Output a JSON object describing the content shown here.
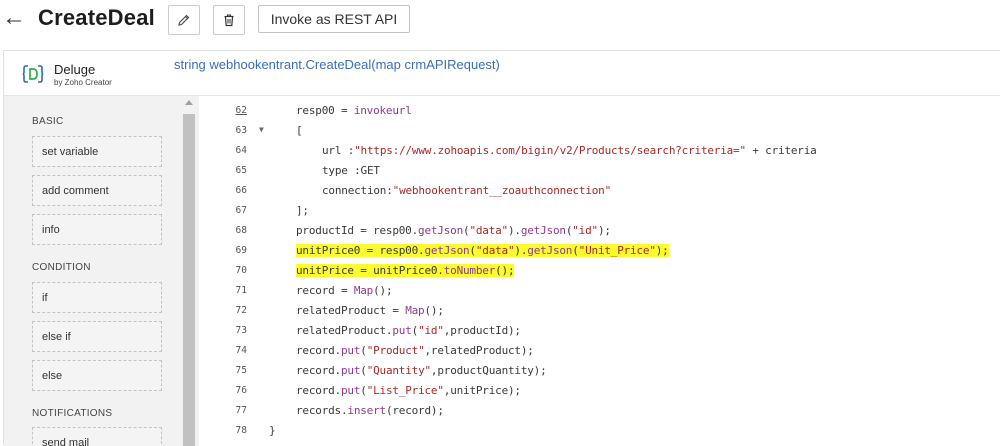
{
  "header": {
    "back_glyph": "←",
    "title": "CreateDeal",
    "rest_button": "Invoke as REST API"
  },
  "editor": {
    "brand": "Deluge",
    "brand_sub": "by Zoho Creator",
    "signature": "string webhookentrant.CreateDeal(map crmAPIRequest)"
  },
  "palette": {
    "sections": [
      {
        "label": "BASIC",
        "items": [
          "set variable",
          "add comment",
          "info"
        ]
      },
      {
        "label": "CONDITION",
        "items": [
          "if",
          "else if",
          "else"
        ]
      },
      {
        "label": "NOTIFICATIONS",
        "items": [
          "send mail"
        ]
      }
    ]
  },
  "code": {
    "lines": [
      {
        "n": "62",
        "text": "resp00 = invokeurl",
        "indent": 1
      },
      {
        "n": "63",
        "text": "[",
        "indent": 1,
        "fold": true
      },
      {
        "n": "64",
        "text": "url :\"https://www.zohoapis.com/bigin/v2/Products/search?criteria=\" + criteria",
        "indent": 2
      },
      {
        "n": "65",
        "text": "type :GET",
        "indent": 2
      },
      {
        "n": "66",
        "text": "connection:\"webhookentrant__zoauthconnection\"",
        "indent": 2
      },
      {
        "n": "67",
        "text": "];",
        "indent": 1
      },
      {
        "n": "68",
        "text": "productId = resp00.getJson(\"data\").getJson(\"id\");",
        "indent": 1
      },
      {
        "n": "69",
        "text": "unitPrice0 = resp00.getJson(\"data\").getJson(\"Unit_Price\");",
        "indent": 1,
        "highlight": true
      },
      {
        "n": "70",
        "text": "unitPrice = unitPrice0.toNumber();",
        "indent": 1,
        "highlight": true
      },
      {
        "n": "71",
        "text": "record = Map();",
        "indent": 1
      },
      {
        "n": "72",
        "text": "relatedProduct = Map();",
        "indent": 1
      },
      {
        "n": "73",
        "text": "relatedProduct.put(\"id\",productId);",
        "indent": 1
      },
      {
        "n": "74",
        "text": "record.put(\"Product\",relatedProduct);",
        "indent": 1
      },
      {
        "n": "75",
        "text": "record.put(\"Quantity\",productQuantity);",
        "indent": 1
      },
      {
        "n": "76",
        "text": "record.put(\"List_Price\",unitPrice);",
        "indent": 1
      },
      {
        "n": "77",
        "text": "records.insert(record);",
        "indent": 1
      },
      {
        "n": "78",
        "text": "}",
        "indent": 0
      }
    ]
  }
}
